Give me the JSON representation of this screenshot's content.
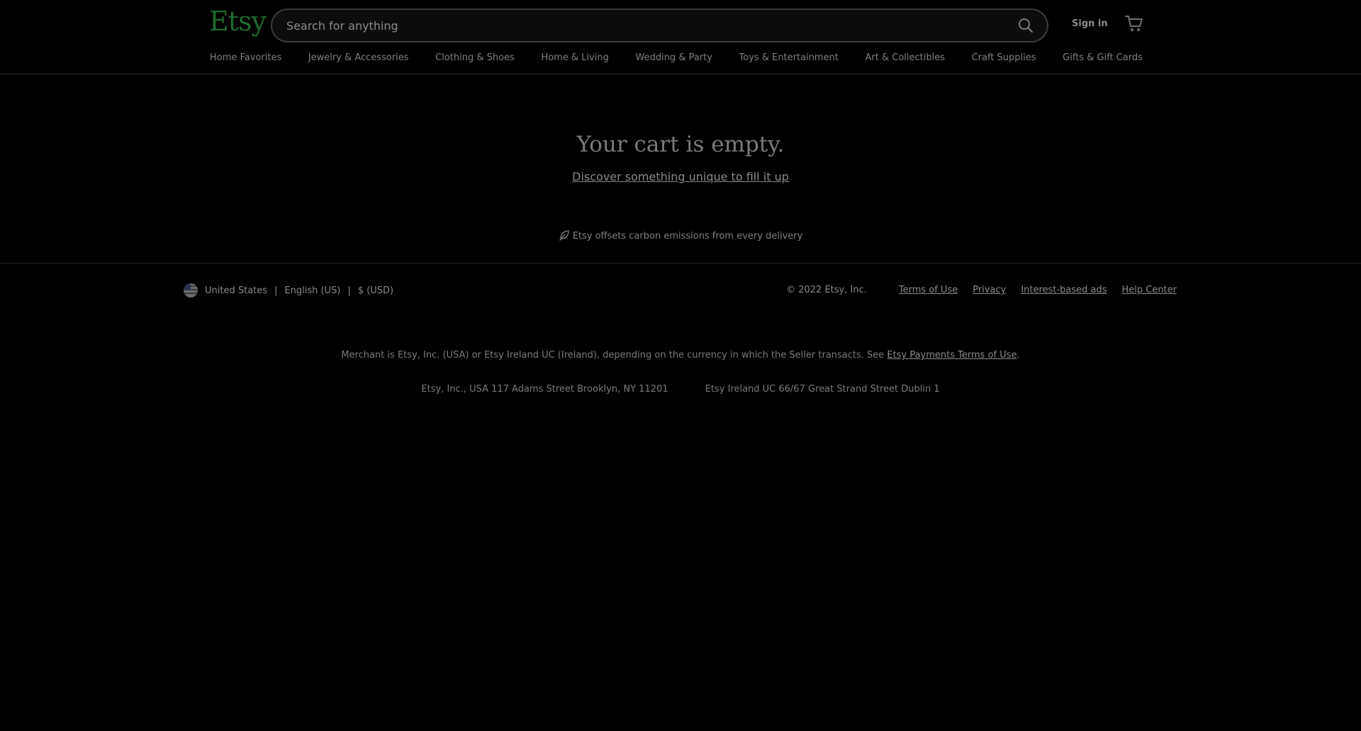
{
  "header": {
    "logo": "Etsy",
    "search_placeholder": "Search for anything",
    "sign_in": "Sign in"
  },
  "nav": {
    "items": [
      "Home Favorites",
      "Jewelry & Accessories",
      "Clothing & Shoes",
      "Home & Living",
      "Wedding & Party",
      "Toys & Entertainment",
      "Art & Collectibles",
      "Craft Supplies",
      "Gifts & Gift Cards"
    ]
  },
  "main": {
    "title": "Your cart is empty.",
    "discover_link": "Discover something unique to fill it up",
    "carbon_note": "Etsy offsets carbon emissions from every delivery"
  },
  "footer": {
    "country": "United States",
    "language": "English (US)",
    "currency": "$ (USD)",
    "separator": "|",
    "copyright": "© 2022 Etsy, Inc.",
    "links": [
      "Terms of Use",
      "Privacy",
      "Interest-based ads",
      "Help Center"
    ],
    "merchant_text": "Merchant is Etsy, Inc. (USA) or Etsy Ireland UC (Ireland), depending on the currency in which the Seller transacts. See",
    "merchant_link": "Etsy Payments Terms of Use",
    "merchant_end": ".",
    "address_us": "Etsy, Inc., USA 117 Adams Street Brooklyn, NY 11201",
    "address_ie": "Etsy Ireland UC 66/67 Great Strand Street Dublin 1"
  },
  "colors": {
    "background": "#000000",
    "logo": "#1e6a2f",
    "text": "#8a8a8a"
  }
}
